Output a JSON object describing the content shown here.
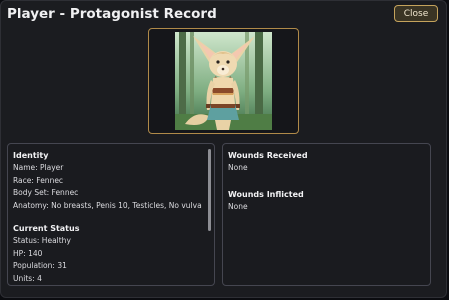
{
  "window": {
    "title": "Player - Protagonist Record",
    "close_label": "Close"
  },
  "portrait": {
    "alt": "Fennec character portrait"
  },
  "identity": {
    "heading": "Identity",
    "name": "Name: Player",
    "race": "Race: Fennec",
    "body_set": "Body Set: Fennec",
    "anatomy": "Anatomy: No breasts, Penis 10, Testicles, No vulva"
  },
  "status": {
    "heading": "Current Status",
    "status": "Status: Healthy",
    "hp": "HP: 140",
    "population": "Population: 31",
    "units": "Units: 4"
  },
  "wounds_received": {
    "heading": "Wounds Received",
    "value": "None"
  },
  "wounds_inflicted": {
    "heading": "Wounds Inflicted",
    "value": "None"
  },
  "colors": {
    "accent": "#c5a35c",
    "panel_border": "#454650",
    "background": "#1b1c20"
  }
}
